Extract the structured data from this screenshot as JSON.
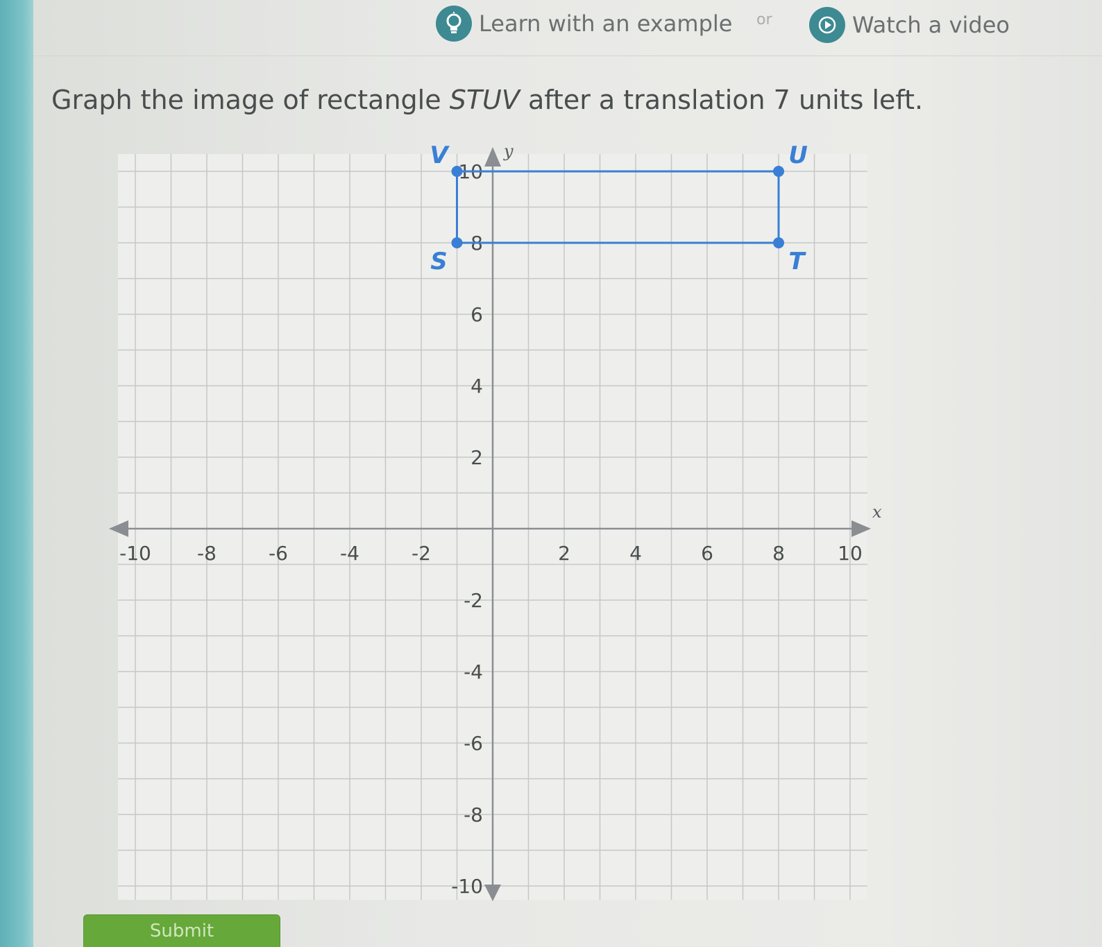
{
  "header": {
    "example_label": "Learn with an example",
    "or_label": "or",
    "video_label": "Watch a video",
    "example_icon": "lightbulb-icon",
    "video_icon": "play-icon"
  },
  "question": {
    "prefix": "Graph the image of rectangle ",
    "shape_name": "STUV",
    "suffix": " after a translation 7 units left."
  },
  "chart_data": {
    "type": "scatter",
    "xlabel": "x",
    "ylabel": "y",
    "xlim": [
      -10,
      10
    ],
    "ylim": [
      -10,
      10
    ],
    "grid": true,
    "grid_step": 1,
    "x_ticks": [
      -10,
      -8,
      -6,
      -4,
      -2,
      2,
      4,
      6,
      8,
      10
    ],
    "y_ticks": [
      10,
      8,
      6,
      4,
      2,
      -2,
      -4,
      -6,
      -8,
      -10
    ],
    "x_tick_labels": [
      "-10",
      "-8",
      "-6",
      "-4",
      "-2",
      "2",
      "4",
      "6",
      "8",
      "10"
    ],
    "y_tick_labels": [
      "10",
      "8",
      "6",
      "4",
      "2",
      "-2",
      "-4",
      "-6",
      "-8",
      "-10"
    ],
    "shape_color": "#3a7fd5",
    "points": [
      {
        "label": "S",
        "x": -1,
        "y": 8
      },
      {
        "label": "T",
        "x": 8,
        "y": 8
      },
      {
        "label": "U",
        "x": 8,
        "y": 10
      },
      {
        "label": "V",
        "x": -1,
        "y": 10
      }
    ]
  },
  "submit": {
    "label": "Submit"
  }
}
